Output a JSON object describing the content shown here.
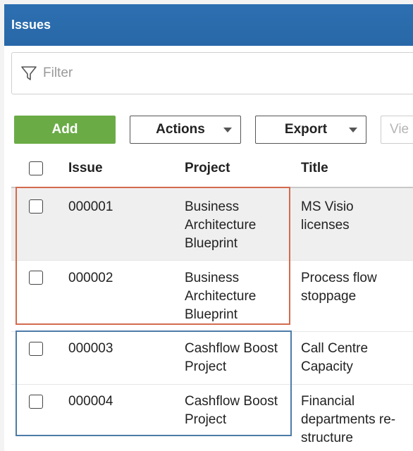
{
  "header": {
    "title": "Issues"
  },
  "filter": {
    "placeholder": "Filter"
  },
  "toolbar": {
    "add_label": "Add",
    "actions_label": "Actions",
    "export_label": "Export",
    "view_label": "Vie"
  },
  "table": {
    "columns": [
      "Issue",
      "Project",
      "Title"
    ],
    "rows": [
      {
        "issue": "000001",
        "project": "Business Architecture Blueprint",
        "title": "MS Visio licenses"
      },
      {
        "issue": "000002",
        "project": "Business Architecture Blueprint",
        "title": "Process flow stoppage"
      },
      {
        "issue": "000003",
        "project": "Cashflow Boost Project",
        "title": "Call Centre Capacity"
      },
      {
        "issue": "000004",
        "project": "Cashflow Boost Project",
        "title": "Financial departments re-structure"
      }
    ]
  },
  "colors": {
    "header_bg": "#2b6cb0",
    "add_button": "#6aab46",
    "highlight_orange": "#d46a4e",
    "highlight_blue": "#4d7ca8"
  }
}
